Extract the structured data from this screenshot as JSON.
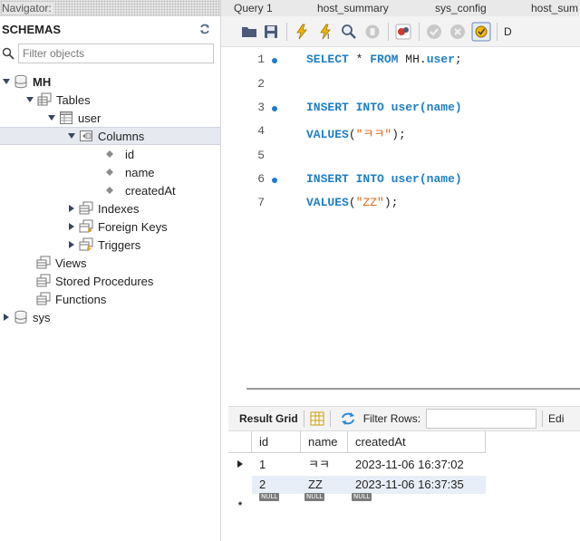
{
  "navigator": {
    "title": "Navigator:",
    "schemas_label": "SCHEMAS",
    "filter_placeholder": "Filter objects",
    "tree": {
      "schema_mh": "MH",
      "tables": "Tables",
      "table_user": "user",
      "columns": "Columns",
      "col_id": "id",
      "col_name": "name",
      "col_created": "createdAt",
      "indexes": "Indexes",
      "foreign_keys": "Foreign Keys",
      "triggers": "Triggers",
      "views": "Views",
      "stored_procedures": "Stored Procedures",
      "functions": "Functions",
      "schema_sys": "sys"
    }
  },
  "tabs": [
    "Query 1",
    "host_summary",
    "sys_config",
    "host_sum"
  ],
  "toolbar": {
    "partial_text": "D"
  },
  "editor": {
    "lines": [
      {
        "num": "1",
        "bp": true
      },
      {
        "num": "2",
        "bp": false
      },
      {
        "num": "3",
        "bp": true
      },
      {
        "num": "4",
        "bp": false
      },
      {
        "num": "5",
        "bp": false
      },
      {
        "num": "6",
        "bp": true
      },
      {
        "num": "7",
        "bp": false
      }
    ],
    "code": {
      "l1_kw1": "SELECT",
      "l1_star": "*",
      "l1_kw2": "FROM",
      "l1_schema": "MH.",
      "l1_table": "user",
      "l1_end": ";",
      "l3_kw": "INSERT INTO",
      "l3_table": "user",
      "l3_cols": "(name)",
      "l4_kw": "VALUES",
      "l4_open": "(",
      "l4_str": "\"ㅋㅋ\"",
      "l4_close": ");",
      "l6_kw": "INSERT INTO",
      "l6_table": "user",
      "l6_cols": "(name)",
      "l7_kw": "VALUES",
      "l7_open": "(",
      "l7_str": "\"ZZ\"",
      "l7_close": ");"
    }
  },
  "result": {
    "grid_label": "Result Grid",
    "filter_rows_label": "Filter Rows:",
    "edit_label": "Edi",
    "columns": [
      "id",
      "name",
      "createdAt"
    ],
    "rows": [
      {
        "id": "1",
        "name": "ㅋㅋ",
        "createdAt": "2023-11-06 16:37:02"
      },
      {
        "id": "2",
        "name": "ZZ",
        "createdAt": "2023-11-06 16:37:35"
      }
    ],
    "null_badge": "NULL",
    "new_row_marker": "*"
  }
}
